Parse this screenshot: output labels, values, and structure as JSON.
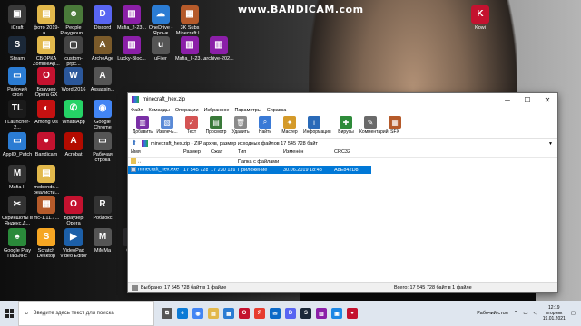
{
  "watermark": "www.BANDICAM.com",
  "desktop_icons": [
    {
      "label": "iCraft",
      "color": "#3a3a3a",
      "glyph": "▣"
    },
    {
      "label": "фото 2019-н...",
      "color": "#e2b84b",
      "glyph": "▤"
    },
    {
      "label": "People Playgroun...",
      "color": "#4a7a3a",
      "glyph": "☻"
    },
    {
      "label": "Discord",
      "color": "#5865f2",
      "glyph": "D"
    },
    {
      "label": "Mafia_2-23...",
      "color": "#8b1fa8",
      "glyph": "▥"
    },
    {
      "label": "OneDrive - Ярлык",
      "color": "#2b7cd3",
      "glyph": "☁"
    },
    {
      "label": "3K Subs Minecraft I...",
      "color": "#b55a2a",
      "glyph": "▦"
    },
    {
      "label": "Steam",
      "color": "#1b2838",
      "glyph": "S"
    },
    {
      "label": "СБОРКА ZombieAp...",
      "color": "#e2b84b",
      "glyph": "▤"
    },
    {
      "label": "custom-prpc...",
      "color": "#444",
      "glyph": "▢"
    },
    {
      "label": "ArcheAge",
      "color": "#7a5a2a",
      "glyph": "A"
    },
    {
      "label": "Lucky-Bloc...",
      "color": "#8b1fa8",
      "glyph": "▥"
    },
    {
      "label": "uFiler",
      "color": "#555",
      "glyph": "u"
    },
    {
      "label": "Mafia_II-23...",
      "color": "#8b1fa8",
      "glyph": "▥"
    },
    {
      "label": "archive-202...",
      "color": "#8b1fa8",
      "glyph": "▥"
    },
    {
      "label": "Рабочий стол",
      "color": "#2b7cd3",
      "glyph": "▭"
    },
    {
      "label": "Браузер Opera GX",
      "color": "#c4122f",
      "glyph": "O"
    },
    {
      "label": "Word 2016",
      "color": "#2b579a",
      "glyph": "W"
    },
    {
      "label": "Assassin...",
      "color": "#555",
      "glyph": "A"
    },
    {
      "label": "TLauncher-2...",
      "color": "#1a1a1a",
      "glyph": "TL"
    },
    {
      "label": "Among Us",
      "color": "#c51111",
      "glyph": "◐"
    },
    {
      "label": "WhatsApp",
      "color": "#25d366",
      "glyph": "✆"
    },
    {
      "label": "Google Chrome",
      "color": "#4285f4",
      "glyph": "◉"
    },
    {
      "label": "AppID_Patch",
      "color": "#2b7cd3",
      "glyph": "▭"
    },
    {
      "label": "Bandicam",
      "color": "#c4122f",
      "glyph": "●"
    },
    {
      "label": "Acrobat",
      "color": "#b30b00",
      "glyph": "A"
    },
    {
      "label": "Рабочая строка",
      "color": "#555",
      "glyph": "▭"
    },
    {
      "label": "Mafia II",
      "color": "#333",
      "glyph": "M"
    },
    {
      "label": "mobendc... реалисти...",
      "color": "#e2b84b",
      "glyph": "▤"
    },
    {
      "label": "Скриншоты в Яндекс.Д...",
      "color": "#333",
      "glyph": "✂"
    },
    {
      "label": "mc-1.11.7...",
      "color": "#b55a2a",
      "glyph": "▦"
    },
    {
      "label": "Браузер Opera",
      "color": "#c4122f",
      "glyph": "O"
    },
    {
      "label": "Роблокс",
      "color": "#333",
      "glyph": "R"
    },
    {
      "label": "Google Play Пасьянс",
      "color": "#2a8a3a",
      "glyph": "♠"
    },
    {
      "label": "Scratch Desktop",
      "color": "#f6a623",
      "glyph": "S"
    },
    {
      "label": "VideoPad Video Editor",
      "color": "#1c5fa8",
      "glyph": "▶"
    },
    {
      "label": "MiMMa",
      "color": "#555",
      "glyph": "M"
    },
    {
      "label": "OBS",
      "color": "#302e31",
      "glyph": "◎"
    },
    {
      "label": "Kowi",
      "color": "#c4122f",
      "glyph": "K"
    }
  ],
  "window": {
    "title": "minecraft_hex.zip",
    "minimize": "─",
    "maximize": "☐",
    "close": "✕",
    "menu": [
      "Файл",
      "Команды",
      "Операции",
      "Избранное",
      "Параметры",
      "Справка"
    ],
    "toolbar": [
      {
        "label": "Добавить",
        "icon": "add-icon",
        "color": "#7a2fa6",
        "glyph": "▥"
      },
      {
        "label": "Извлечь...",
        "icon": "extract-icon",
        "color": "#5a8ad6",
        "glyph": "▧"
      },
      {
        "label": "Тест",
        "icon": "test-icon",
        "color": "#d45454",
        "glyph": "✓"
      },
      {
        "label": "Просмотр",
        "icon": "view-icon",
        "color": "#3a7a3a",
        "glyph": "▤"
      },
      {
        "label": "Удалить",
        "icon": "delete-icon",
        "color": "#8a8a8a",
        "glyph": "🗑"
      },
      {
        "label": "Найти",
        "icon": "find-icon",
        "color": "#3a7ad6",
        "glyph": "⌕"
      },
      {
        "label": "Мастер",
        "icon": "wizard-icon",
        "color": "#d49a2a",
        "glyph": "✦"
      },
      {
        "label": "Информация",
        "icon": "info-icon",
        "color": "#2a6ab8",
        "glyph": "i"
      },
      {
        "label": "Вирусы",
        "icon": "virus-icon",
        "color": "#2e8b3a",
        "glyph": "✚"
      },
      {
        "label": "Комментарий",
        "icon": "comment-icon",
        "color": "#6a6a6a",
        "glyph": "✎"
      },
      {
        "label": "SFX",
        "icon": "sfx-icon",
        "color": "#b55a2a",
        "glyph": "▦"
      }
    ],
    "path": "minecraft_hex.zip - ZIP архив, размер исходных файлов 17 545 728 байт",
    "columns": [
      "Имя",
      "Размер",
      "Сжат",
      "Тип",
      "Изменён",
      "CRC32"
    ],
    "folder_row": {
      "name": "..",
      "type": "Папка с файлами"
    },
    "file_row": {
      "name": "minecraft_hex.exe",
      "size": "17 545 728",
      "packed": "17 230 139",
      "type": "Приложение",
      "modified": "30.06.2019 18:48",
      "crc": "A8E842D8"
    },
    "status_left": "Выбрано: 17 545 728 байт в 1 файле",
    "status_right": "Всего: 17 545 728 байт в 1 файле"
  },
  "taskbar": {
    "search_placeholder": "Введите здесь текст для поиска",
    "apps": [
      {
        "name": "task-view",
        "color": "#555",
        "glyph": "⧉"
      },
      {
        "name": "edge",
        "color": "#0c7bd6",
        "glyph": "e"
      },
      {
        "name": "chrome",
        "color": "#4285f4",
        "glyph": "◉"
      },
      {
        "name": "explorer",
        "color": "#e2b84b",
        "glyph": "▤"
      },
      {
        "name": "store",
        "color": "#2b7cd3",
        "glyph": "▦"
      },
      {
        "name": "opera",
        "color": "#c4122f",
        "glyph": "O"
      },
      {
        "name": "yandex",
        "color": "#e63c2f",
        "glyph": "Я"
      },
      {
        "name": "mail",
        "color": "#0b69c7",
        "glyph": "✉"
      },
      {
        "name": "discord",
        "color": "#5865f2",
        "glyph": "D"
      },
      {
        "name": "steam",
        "color": "#1b2838",
        "glyph": "S"
      },
      {
        "name": "winrar",
        "color": "#8b1fa8",
        "glyph": "▥"
      },
      {
        "name": "photos",
        "color": "#1e88e5",
        "glyph": "▣"
      },
      {
        "name": "bandicam",
        "color": "#c4122f",
        "glyph": "●"
      }
    ],
    "desktop_label": "Рабочий стол",
    "time": "12:19",
    "day": "вторник",
    "date": "19.01.2021"
  }
}
